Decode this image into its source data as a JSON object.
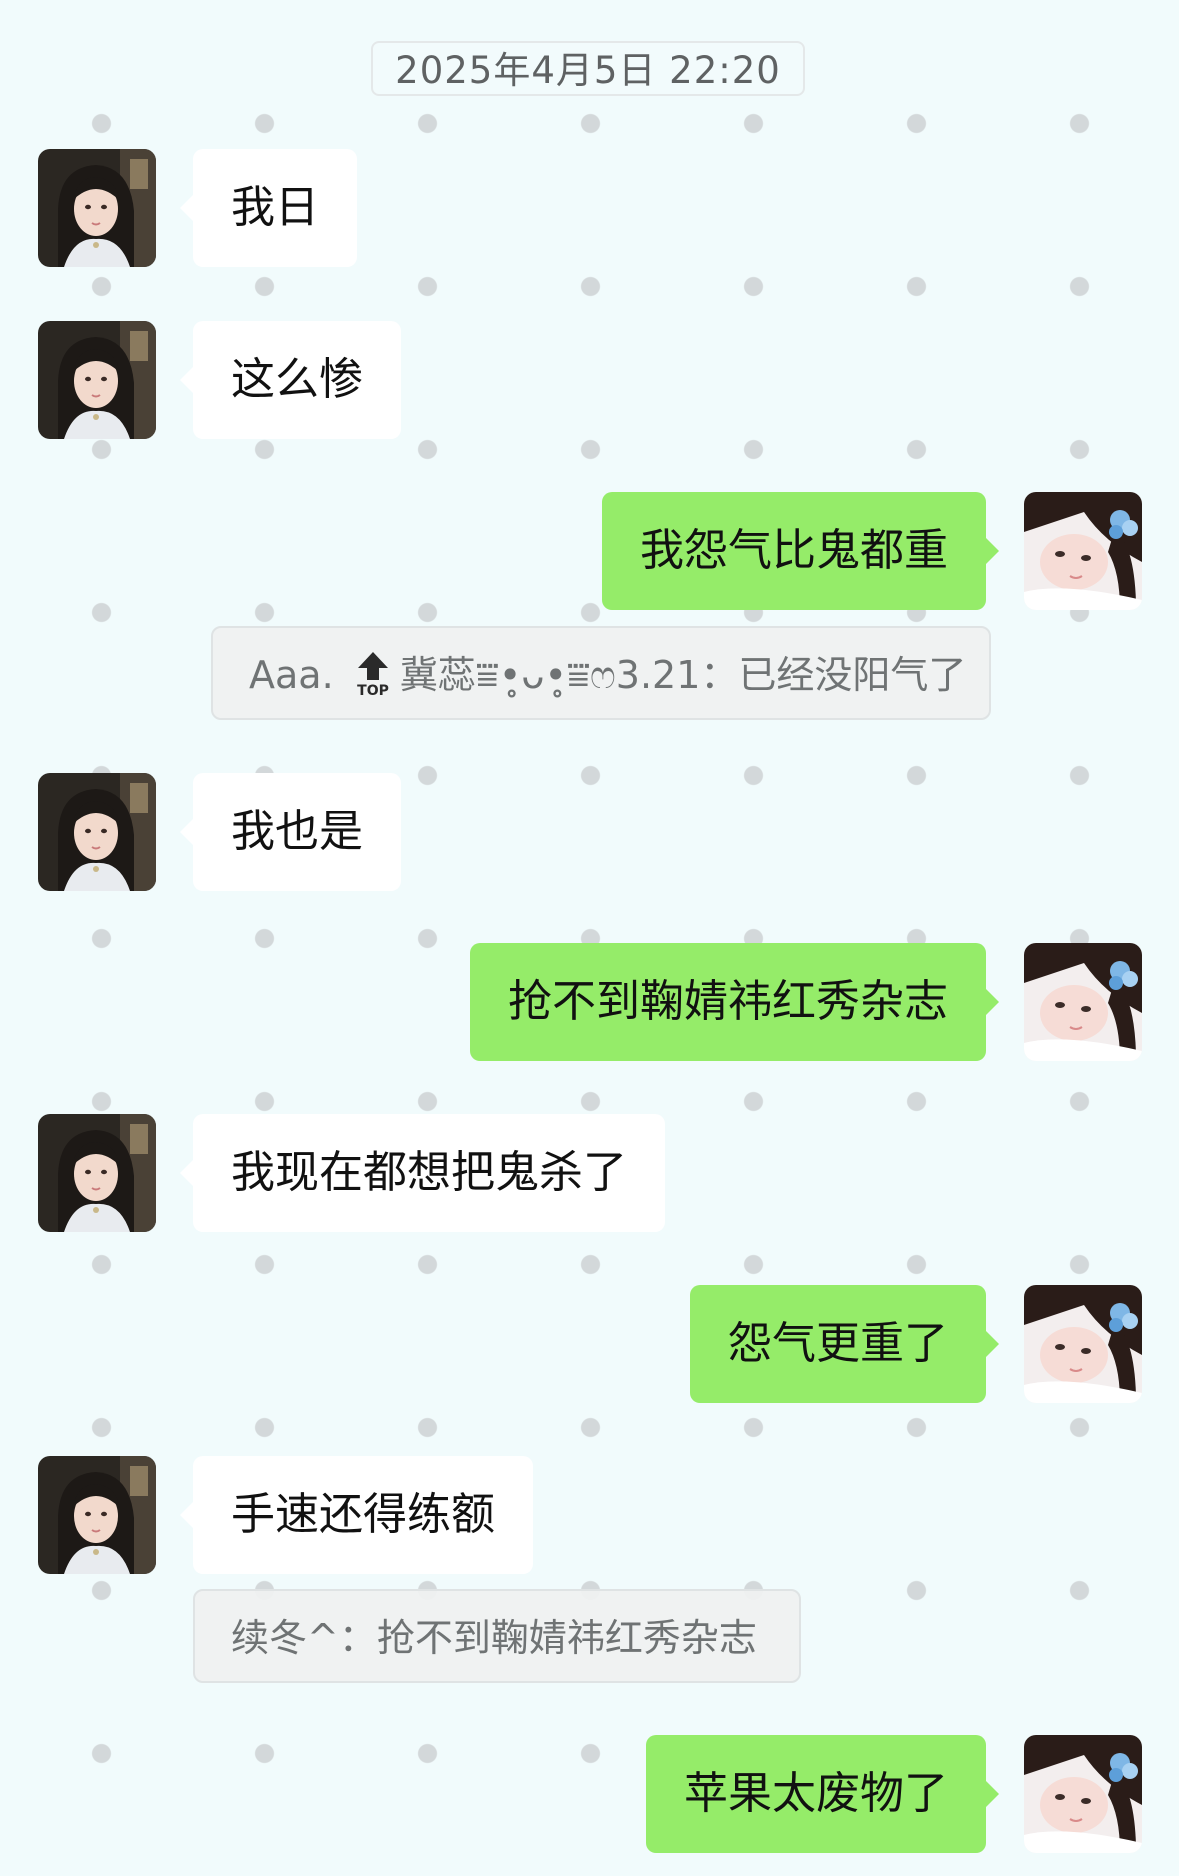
{
  "timestamp": "2025年4月5日 22:20",
  "messages": [
    {
      "side": "left",
      "text": "我日"
    },
    {
      "side": "left",
      "text": "这么惨"
    },
    {
      "side": "right",
      "text": "我怨气比鬼都重"
    },
    {
      "side": "left",
      "text": "我也是"
    },
    {
      "side": "right",
      "text": "抢不到鞠婧祎红秀杂志"
    },
    {
      "side": "left",
      "text": "我现在都想把鬼杀了"
    },
    {
      "side": "right",
      "text": "怨气更重了"
    },
    {
      "side": "left",
      "text": "手速还得练额"
    },
    {
      "side": "right",
      "text": "苹果太废物了"
    }
  ],
  "quotes": [
    {
      "prefix": "Aaa.",
      "badge": "TOP",
      "rest": "冀蕊⩸•̥ᴗ•̥⩸ෆ3.21：已经没阳气了"
    },
    {
      "text": "续冬^：抢不到鞠婧祎红秀杂志"
    }
  ],
  "colors": {
    "background": "#f1fbfc",
    "dots": "#d3d8da",
    "bubble_left": "#ffffff",
    "bubble_right": "#95ec69",
    "quote_bg": "#eff1f1",
    "badge_dark": "#2a2a2a"
  },
  "icons": {
    "avatar_left": "friend-avatar-icon",
    "avatar_right": "my-avatar-icon",
    "badge": "top-arrow-badge-icon"
  }
}
